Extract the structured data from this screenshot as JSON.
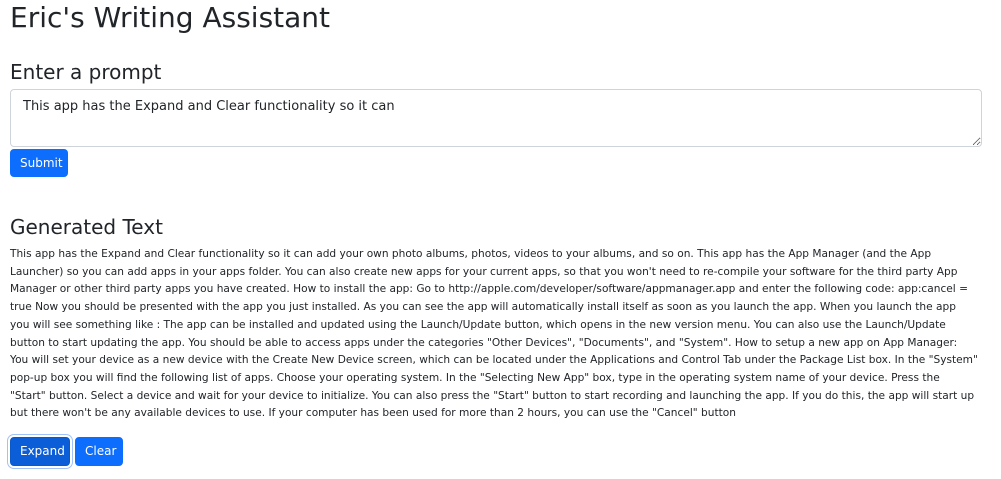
{
  "header": {
    "title": "Eric's Writing Assistant"
  },
  "prompt_section": {
    "heading": "Enter a prompt",
    "input_value": "This app has the Expand and Clear functionality so it can",
    "submit_label": "Submit"
  },
  "output_section": {
    "heading": "Generated Text",
    "text": "This app has the Expand and Clear functionality so it can  add your own photo albums, photos, videos to your albums, and so on. This app has  the App Manager (and the App Launcher) so you can add apps in your apps folder. You can also create new apps for your current apps, so that you won't need to re-compile your software for the third party App Manager or other third party apps you have created. How to install the app: Go to http://apple.com/developer/software/appmanager.app and enter the following code: app:cancel = true Now you should be presented with the app you just installed. As you can see the app will automatically install itself as soon as you launch the app. When you launch the app you will see something like : The app can be installed and updated using the Launch/Update button, which opens in the new version menu. You can also use the Launch/Update button to start updating the app. You should be able to access apps under the categories \"Other Devices\", \"Documents\", and \"System\". How to setup a new app on App Manager: You will set your device as a new device with the Create New Device screen, which can be located under the Applications and Control Tab under the Package List box. In the \"System\" pop-up box you will find the following list of apps. Choose your operating system. In the \"Selecting New App\" box, type in the operating system name of your device. Press the \"Start\" button. Select a device and wait for your device to initialize. You can also press the \"Start\" button to start recording and launching the app. If you do this, the app will start up but there won't be any available devices to use. If your computer has been used for more than 2 hours, you can use the \"Cancel\" button",
    "expand_label": "Expand",
    "clear_label": "Clear"
  },
  "colors": {
    "primary": "#0d6efd",
    "primary_focused": "#0b5ed7",
    "text": "#212529",
    "input_border": "#ced4da"
  }
}
